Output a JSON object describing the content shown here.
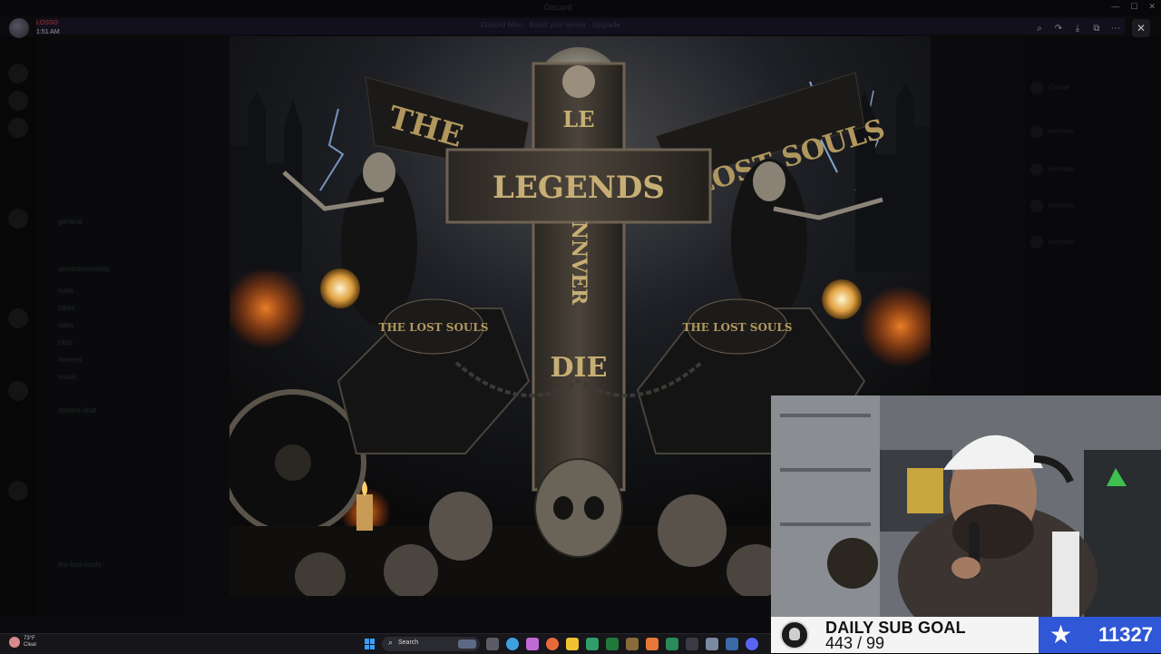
{
  "window": {
    "title": "Discord",
    "banner_text": "Discord Nitro · Boost your server · Upgrade"
  },
  "overlay_user": {
    "name": "LOSSO",
    "time": "1:51 AM"
  },
  "viewer_toolbar": {
    "zoom_icon": "zoom-in-icon",
    "forward_icon": "forward-icon",
    "download_icon": "download-icon",
    "open_icon": "open-external-icon",
    "more_icon": "more-icon",
    "close_icon": "close-icon"
  },
  "channels": [
    "general",
    "announcements",
    "rules",
    "bikes",
    "rides",
    "clips",
    "memes",
    "music",
    "stream-chat",
    "the-lost-souls"
  ],
  "members": [
    "Online",
    "member",
    "member",
    "member",
    "member"
  ],
  "image_text": {
    "banner_left": "THE",
    "banner_right": "LOST SOULS",
    "cross_horizontal": "LEGENDS",
    "cross_vertical_1": "LE",
    "cross_vertical_2": "NNVER",
    "cross_bottom": "DIE",
    "tank_left": "THE LOST SOULS",
    "tank_right": "THE LOST SOULS"
  },
  "sub_goal": {
    "title": "DAILY SUB GOAL",
    "count": "443 / 99",
    "total": "11327"
  },
  "taskbar": {
    "weather_temp": "73°F",
    "weather_desc": "Clear",
    "search_label": "Search"
  },
  "colors": {
    "sub_blue": "#2f57d6",
    "background": "#050506",
    "gold": "#b0975e"
  }
}
